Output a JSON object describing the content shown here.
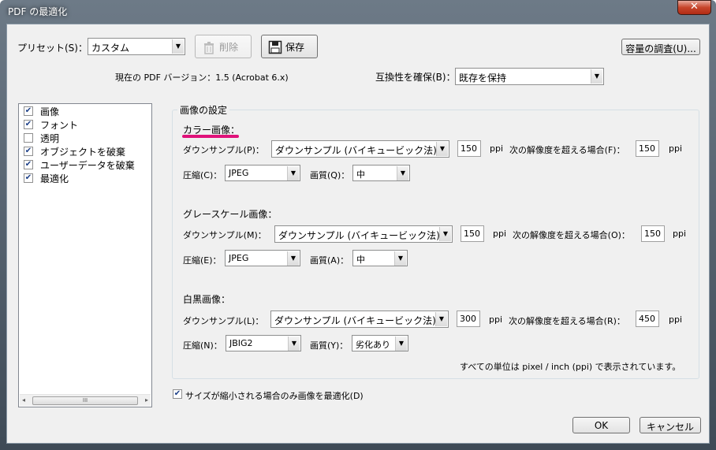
{
  "window": {
    "title": "PDF の最適化",
    "close_label": "✕"
  },
  "top": {
    "preset_label": "プリセット(S)：",
    "preset_value": "カスタム",
    "delete_label": "削除",
    "save_label": "保存",
    "audit_label": "容量の調査(U)...",
    "version_label": "現在の PDF バージョン：1.5 (Acrobat 6.x)",
    "compat_label": "互換性を確保(B)：",
    "compat_value": "既存を保持"
  },
  "sidebar": {
    "items": [
      {
        "label": "画像",
        "checked": true,
        "selected": true
      },
      {
        "label": "フォント",
        "checked": true,
        "selected": false
      },
      {
        "label": "透明",
        "checked": false,
        "selected": false
      },
      {
        "label": "オブジェクトを破棄",
        "checked": true,
        "selected": false
      },
      {
        "label": "ユーザーデータを破棄",
        "checked": true,
        "selected": false
      },
      {
        "label": "最適化",
        "checked": true,
        "selected": false
      }
    ],
    "scroll_left": "◂",
    "scroll_right": "▸",
    "scroll_grip": "III"
  },
  "image_settings": {
    "group_title": "画像の設定",
    "color": {
      "title": "カラー画像：",
      "downsample_label": "ダウンサンプル(P)：",
      "downsample_value": "ダウンサンプル (バイキュービック法)",
      "ppi1": "150",
      "ppi_unit": "ppi",
      "above_label": "次の解像度を超える場合(F)：",
      "ppi2": "150",
      "compress_label": "圧縮(C)：",
      "compress_value": "JPEG",
      "quality_label": "画質(Q)：",
      "quality_value": "中"
    },
    "gray": {
      "title": "グレースケール画像：",
      "downsample_label": "ダウンサンプル(M)：",
      "downsample_value": "ダウンサンプル (バイキュービック法)",
      "ppi1": "150",
      "ppi_unit": "ppi",
      "above_label": "次の解像度を超える場合(O)：",
      "ppi2": "150",
      "compress_label": "圧縮(E)：",
      "compress_value": "JPEG",
      "quality_label": "画質(A)：",
      "quality_value": "中"
    },
    "mono": {
      "title": "白黒画像：",
      "downsample_label": "ダウンサンプル(L)：",
      "downsample_value": "ダウンサンプル (バイキュービック法)",
      "ppi1": "300",
      "ppi_unit": "ppi",
      "above_label": "次の解像度を超える場合(R)：",
      "ppi2": "450",
      "compress_label": "圧縮(N)：",
      "compress_value": "JBIG2",
      "quality_label": "画質(Y)：",
      "quality_value": "劣化あり"
    },
    "units_note": "すべての単位は pixel / inch (ppi) で表示されています。"
  },
  "footer": {
    "only_shrink_label": "サイズが縮小される場合のみ画像を最適化(D)",
    "only_shrink_checked": true,
    "ok_label": "OK",
    "cancel_label": "キャンセル"
  },
  "colors": {
    "accent_underline": "#e0127a",
    "close_red": "#c7452b"
  }
}
